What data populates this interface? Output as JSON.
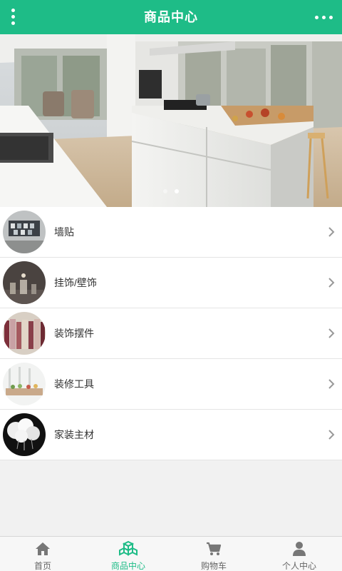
{
  "header": {
    "title": "商品中心",
    "menu_icon": "vertical-dots-icon",
    "more_icon": "horizontal-dots-icon",
    "accent_color": "#1ebc87"
  },
  "banner": {
    "image": "kitchen-interior-photo",
    "slide_count": 2,
    "active_slide": 2
  },
  "categories": [
    {
      "label": "墙贴",
      "thumbnail": "wall-sticker-photo"
    },
    {
      "label": "挂饰/壁饰",
      "thumbnail": "wall-decor-photo"
    },
    {
      "label": "装饰摆件",
      "thumbnail": "ornaments-photo"
    },
    {
      "label": "装修工具",
      "thumbnail": "decoration-tools-photo"
    },
    {
      "label": "家装主材",
      "thumbnail": "home-materials-photo"
    }
  ],
  "tabbar": {
    "active_index": 1,
    "tabs": [
      {
        "label": "首页",
        "icon": "home-icon"
      },
      {
        "label": "商品中心",
        "icon": "cubes-icon"
      },
      {
        "label": "购物车",
        "icon": "cart-icon"
      },
      {
        "label": "个人中心",
        "icon": "user-icon"
      }
    ]
  }
}
